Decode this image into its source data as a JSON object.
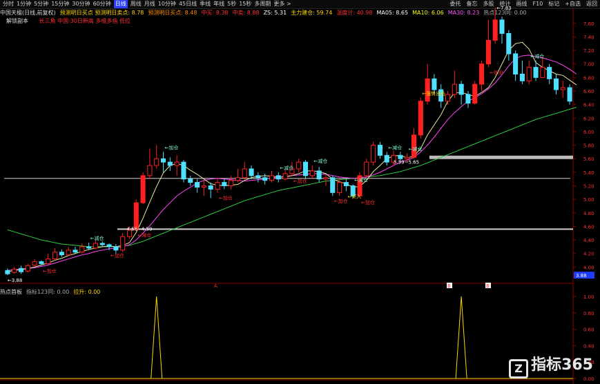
{
  "toolbar": {
    "timeframes": [
      "分时",
      "1分钟",
      "5分钟",
      "15分钟",
      "30分钟",
      "60分钟",
      "日线",
      "周线",
      "月线",
      "10分钟",
      "45日线",
      "季线",
      "年线",
      "5秒",
      "15秒",
      "多周期",
      "更多 >"
    ],
    "active_index": 6,
    "right": [
      "委托",
      "备忘",
      "多股",
      "统计",
      "画线",
      "F10",
      "标记",
      "+自选",
      "返回"
    ]
  },
  "infobar": {
    "title": "中国天楹(日线,前复权)",
    "items": [
      {
        "text": "预测明日买点 预测明日卖点: 8.78",
        "color": "#ffd700"
      },
      {
        "text": "预测明日买点: 8.48",
        "color": "#ff8c00"
      },
      {
        "text": "中买: 8.38",
        "color": "#ff3030"
      },
      {
        "text": "中卖: 8.88",
        "color": "#ff3030"
      },
      {
        "text": "ZS: 5.31",
        "color": "#ffffff"
      },
      {
        "text": "主力建仓: 59.74",
        "color": "#ffd700"
      },
      {
        "text": "温度计: 40.98",
        "color": "#ff3030"
      },
      {
        "text": "MA05: 8.65",
        "color": "#ffffff"
      },
      {
        "text": "MA10: 6.06",
        "color": "#ffff00"
      },
      {
        "text": "MA30: 8.23",
        "color": "#ff55ff"
      },
      {
        "text": "热点123同: 0.00",
        "color": "#aaaaaa"
      }
    ]
  },
  "tags": {
    "box": "解锁副本",
    "formula": "长三角 中国·30日新高 多维多指 低位"
  },
  "indbar": {
    "items": [
      {
        "text": "热点首板",
        "color": "#dddddd"
      },
      {
        "text": "指标123同: 0.00",
        "color": "#aaaaaa"
      },
      {
        "text": "拉升: 0.00",
        "color": "#ffd700"
      }
    ]
  },
  "axis": {
    "main": [
      "7.60",
      "7.40",
      "7.20",
      "7.00",
      "6.80",
      "6.60",
      "6.40",
      "6.20",
      "6.00",
      "5.80",
      "5.60",
      "5.40",
      "5.20",
      "5.00",
      "4.80",
      "4.60",
      "4.40",
      "4.20",
      "4.00"
    ],
    "current_price": "3.88",
    "sub": [
      "1.00",
      "0.80",
      "0.60",
      "0.40",
      "0.20",
      "0.00"
    ]
  },
  "annotations": {
    "high": "7.83",
    "low": "3.88",
    "level1": "4.56~4.59",
    "level2": "5.59~5.65",
    "labels": [
      "加仓",
      "减仓",
      "加仓",
      "减仓",
      "加仓",
      "加仓",
      "减仓",
      "加仓",
      "减仓",
      "加仓",
      "减仓",
      "加仓",
      "买入",
      "减仓",
      "减仓",
      "强势出击",
      "加仓",
      "减仓"
    ]
  },
  "markers": {
    "a1": "A",
    "a2": "A",
    "b1": "B",
    "b2": "B"
  },
  "chart_data": {
    "type": "line",
    "title": "中国天楹(日线,前复权)",
    "ylim": [
      3.8,
      7.7
    ],
    "candles": [
      {
        "o": 3.95,
        "c": 3.9,
        "h": 3.98,
        "l": 3.88
      },
      {
        "o": 3.92,
        "c": 3.97,
        "h": 4.0,
        "l": 3.9
      },
      {
        "o": 3.98,
        "c": 3.93,
        "h": 4.02,
        "l": 3.9
      },
      {
        "o": 3.94,
        "c": 4.02,
        "h": 4.05,
        "l": 3.92
      },
      {
        "o": 4.03,
        "c": 4.08,
        "h": 4.12,
        "l": 4.0
      },
      {
        "o": 4.08,
        "c": 4.05,
        "h": 4.1,
        "l": 4.02
      },
      {
        "o": 4.05,
        "c": 4.12,
        "h": 4.2,
        "l": 4.03
      },
      {
        "o": 4.12,
        "c": 4.22,
        "h": 4.28,
        "l": 4.1
      },
      {
        "o": 4.22,
        "c": 4.18,
        "h": 4.26,
        "l": 4.15
      },
      {
        "o": 4.18,
        "c": 4.25,
        "h": 4.3,
        "l": 4.16
      },
      {
        "o": 4.25,
        "c": 4.22,
        "h": 4.3,
        "l": 4.2
      },
      {
        "o": 4.22,
        "c": 4.3,
        "h": 4.35,
        "l": 4.2
      },
      {
        "o": 4.3,
        "c": 4.28,
        "h": 4.36,
        "l": 4.25
      },
      {
        "o": 4.28,
        "c": 4.35,
        "h": 4.4,
        "l": 4.26
      },
      {
        "o": 4.35,
        "c": 4.33,
        "h": 4.38,
        "l": 4.3
      },
      {
        "o": 4.33,
        "c": 4.3,
        "h": 4.35,
        "l": 4.25
      },
      {
        "o": 4.3,
        "c": 4.25,
        "h": 4.34,
        "l": 4.2
      },
      {
        "o": 4.25,
        "c": 4.45,
        "h": 4.5,
        "l": 4.22
      },
      {
        "o": 4.45,
        "c": 4.55,
        "h": 4.6,
        "l": 4.42
      },
      {
        "o": 4.55,
        "c": 4.95,
        "h": 5.0,
        "l": 4.55
      },
      {
        "o": 4.95,
        "c": 5.35,
        "h": 5.4,
        "l": 4.93
      },
      {
        "o": 5.35,
        "c": 5.5,
        "h": 5.75,
        "l": 5.3
      },
      {
        "o": 5.5,
        "c": 5.6,
        "h": 5.8,
        "l": 5.45
      },
      {
        "o": 5.6,
        "c": 5.55,
        "h": 5.7,
        "l": 5.4
      },
      {
        "o": 5.55,
        "c": 5.5,
        "h": 5.62,
        "l": 5.42
      },
      {
        "o": 5.5,
        "c": 5.55,
        "h": 5.65,
        "l": 5.35
      },
      {
        "o": 5.55,
        "c": 5.3,
        "h": 5.58,
        "l": 5.25
      },
      {
        "o": 5.3,
        "c": 5.25,
        "h": 5.35,
        "l": 5.2
      },
      {
        "o": 5.25,
        "c": 5.18,
        "h": 5.3,
        "l": 5.1
      },
      {
        "o": 5.18,
        "c": 5.2,
        "h": 5.28,
        "l": 5.05
      },
      {
        "o": 5.2,
        "c": 5.15,
        "h": 5.25,
        "l": 5.02
      },
      {
        "o": 5.15,
        "c": 5.25,
        "h": 5.32,
        "l": 5.1
      },
      {
        "o": 5.25,
        "c": 5.2,
        "h": 5.3,
        "l": 5.15
      },
      {
        "o": 5.2,
        "c": 5.28,
        "h": 5.35,
        "l": 5.15
      },
      {
        "o": 5.28,
        "c": 5.32,
        "h": 5.45,
        "l": 5.25
      },
      {
        "o": 5.32,
        "c": 5.45,
        "h": 5.55,
        "l": 5.28
      },
      {
        "o": 5.45,
        "c": 5.35,
        "h": 5.5,
        "l": 5.3
      },
      {
        "o": 5.35,
        "c": 5.32,
        "h": 5.4,
        "l": 5.25
      },
      {
        "o": 5.32,
        "c": 5.28,
        "h": 5.38,
        "l": 5.22
      },
      {
        "o": 5.28,
        "c": 5.35,
        "h": 5.42,
        "l": 5.25
      },
      {
        "o": 5.35,
        "c": 5.3,
        "h": 5.4,
        "l": 5.25
      },
      {
        "o": 5.3,
        "c": 5.38,
        "h": 5.45,
        "l": 5.28
      },
      {
        "o": 5.38,
        "c": 5.45,
        "h": 5.55,
        "l": 5.35
      },
      {
        "o": 5.45,
        "c": 5.55,
        "h": 5.6,
        "l": 5.4
      },
      {
        "o": 5.55,
        "c": 5.35,
        "h": 5.58,
        "l": 5.3
      },
      {
        "o": 5.35,
        "c": 5.42,
        "h": 5.5,
        "l": 5.3
      },
      {
        "o": 5.42,
        "c": 5.3,
        "h": 5.48,
        "l": 5.25
      },
      {
        "o": 5.3,
        "c": 5.32,
        "h": 5.36,
        "l": 5.2
      },
      {
        "o": 5.32,
        "c": 5.1,
        "h": 5.35,
        "l": 5.05
      },
      {
        "o": 5.1,
        "c": 5.25,
        "h": 5.3,
        "l": 5.05
      },
      {
        "o": 5.25,
        "c": 5.2,
        "h": 5.3,
        "l": 5.12
      },
      {
        "o": 5.2,
        "c": 5.05,
        "h": 5.22,
        "l": 5.02
      },
      {
        "o": 5.05,
        "c": 5.35,
        "h": 5.4,
        "l": 5.03
      },
      {
        "o": 5.35,
        "c": 5.55,
        "h": 5.6,
        "l": 5.3
      },
      {
        "o": 5.55,
        "c": 5.8,
        "h": 5.85,
        "l": 5.5
      },
      {
        "o": 5.8,
        "c": 5.65,
        "h": 5.85,
        "l": 5.6
      },
      {
        "o": 5.65,
        "c": 5.55,
        "h": 5.7,
        "l": 5.5
      },
      {
        "o": 5.55,
        "c": 5.65,
        "h": 5.72,
        "l": 5.5
      },
      {
        "o": 5.65,
        "c": 5.6,
        "h": 5.7,
        "l": 5.55
      },
      {
        "o": 5.6,
        "c": 5.62,
        "h": 5.68,
        "l": 5.55
      },
      {
        "o": 5.62,
        "c": 5.95,
        "h": 6.05,
        "l": 5.6
      },
      {
        "o": 5.95,
        "c": 6.45,
        "h": 6.5,
        "l": 5.9
      },
      {
        "o": 6.45,
        "c": 6.78,
        "h": 7.0,
        "l": 6.4
      },
      {
        "o": 6.78,
        "c": 6.62,
        "h": 6.85,
        "l": 6.55
      },
      {
        "o": 6.62,
        "c": 6.45,
        "h": 6.7,
        "l": 6.35
      },
      {
        "o": 6.45,
        "c": 6.55,
        "h": 6.6,
        "l": 6.4
      },
      {
        "o": 6.55,
        "c": 6.7,
        "h": 6.9,
        "l": 6.5
      },
      {
        "o": 6.7,
        "c": 6.55,
        "h": 6.75,
        "l": 6.4
      },
      {
        "o": 6.55,
        "c": 6.42,
        "h": 6.6,
        "l": 6.35
      },
      {
        "o": 6.42,
        "c": 6.7,
        "h": 6.75,
        "l": 6.4
      },
      {
        "o": 6.7,
        "c": 7.0,
        "h": 7.05,
        "l": 6.6
      },
      {
        "o": 7.0,
        "c": 7.35,
        "h": 7.65,
        "l": 6.95
      },
      {
        "o": 7.35,
        "c": 7.65,
        "h": 7.83,
        "l": 7.3
      },
      {
        "o": 7.65,
        "c": 7.45,
        "h": 7.7,
        "l": 7.3
      },
      {
        "o": 7.45,
        "c": 7.15,
        "h": 7.5,
        "l": 7.05
      },
      {
        "o": 7.15,
        "c": 6.85,
        "h": 7.2,
        "l": 6.75
      },
      {
        "o": 6.85,
        "c": 6.75,
        "h": 7.05,
        "l": 6.7
      },
      {
        "o": 6.75,
        "c": 6.95,
        "h": 7.05,
        "l": 6.7
      },
      {
        "o": 6.95,
        "c": 6.8,
        "h": 7.05,
        "l": 6.75
      },
      {
        "o": 6.8,
        "c": 6.95,
        "h": 7.1,
        "l": 6.8
      },
      {
        "o": 6.95,
        "c": 6.78,
        "h": 7.0,
        "l": 6.7
      },
      {
        "o": 6.78,
        "c": 6.62,
        "h": 6.85,
        "l": 6.55
      },
      {
        "o": 6.62,
        "c": 6.65,
        "h": 6.75,
        "l": 6.5
      },
      {
        "o": 6.65,
        "c": 6.45,
        "h": 6.7,
        "l": 6.4
      }
    ],
    "h_levels": [
      5.62,
      5.31,
      4.56
    ],
    "ma5": [
      3.93,
      3.95,
      3.96,
      3.98,
      4.0,
      4.03,
      4.06,
      4.1,
      4.13,
      4.17,
      4.2,
      4.23,
      4.26,
      4.28,
      4.3,
      4.31,
      4.3,
      4.32,
      4.36,
      4.51,
      4.72,
      4.96,
      5.19,
      5.39,
      5.5,
      5.53,
      5.5,
      5.43,
      5.37,
      5.3,
      5.23,
      5.21,
      5.2,
      5.21,
      5.22,
      5.28,
      5.32,
      5.34,
      5.35,
      5.34,
      5.33,
      5.33,
      5.35,
      5.38,
      5.42,
      5.42,
      5.41,
      5.38,
      5.3,
      5.26,
      5.23,
      5.18,
      5.19,
      5.28,
      5.41,
      5.5,
      5.6,
      5.64,
      5.65,
      5.61,
      5.64,
      5.75,
      5.95,
      6.1,
      6.25,
      6.45,
      6.57,
      6.58,
      6.55,
      6.52,
      6.58,
      6.65,
      6.8,
      7.0,
      7.2,
      7.3,
      7.32,
      7.22,
      7.02,
      6.95,
      6.9,
      6.85,
      6.83,
      6.76,
      6.69
    ],
    "ma10": [
      3.95,
      3.96,
      3.97,
      3.98,
      3.99,
      4.01,
      4.03,
      4.06,
      4.09,
      4.12,
      4.15,
      4.18,
      4.2,
      4.23,
      4.25,
      4.27,
      4.28,
      4.3,
      4.33,
      4.4,
      4.5,
      4.61,
      4.73,
      4.85,
      4.95,
      5.05,
      5.12,
      5.18,
      5.24,
      5.28,
      5.3,
      5.31,
      5.3,
      5.29,
      5.28,
      5.27,
      5.28,
      5.29,
      5.3,
      5.32,
      5.33,
      5.34,
      5.35,
      5.36,
      5.37,
      5.38,
      5.38,
      5.37,
      5.35,
      5.33,
      5.32,
      5.31,
      5.32,
      5.33,
      5.36,
      5.4,
      5.45,
      5.5,
      5.55,
      5.58,
      5.62,
      5.7,
      5.8,
      5.92,
      6.05,
      6.18,
      6.28,
      6.37,
      6.45,
      6.5,
      6.56,
      6.63,
      6.72,
      6.84,
      6.97,
      7.08,
      7.12,
      7.13,
      7.11,
      7.09,
      7.06,
      7.03,
      6.98,
      6.92,
      6.85
    ],
    "ma30": [
      4.55,
      4.52,
      4.49,
      4.46,
      4.43,
      4.4,
      4.38,
      4.36,
      4.34,
      4.33,
      4.32,
      4.31,
      4.3,
      4.3,
      4.3,
      4.3,
      4.3,
      4.31,
      4.32,
      4.35,
      4.38,
      4.42,
      4.46,
      4.5,
      4.54,
      4.58,
      4.62,
      4.66,
      4.7,
      4.74,
      4.78,
      4.82,
      4.86,
      4.9,
      4.94,
      4.98,
      5.01,
      5.04,
      5.07,
      5.1,
      5.13,
      5.15,
      5.17,
      5.19,
      5.21,
      5.23,
      5.25,
      5.27,
      5.28,
      5.29,
      5.3,
      5.31,
      5.32,
      5.33,
      5.34,
      5.35,
      5.37,
      5.39,
      5.41,
      5.44,
      5.47,
      5.5,
      5.54,
      5.58,
      5.62,
      5.66,
      5.7,
      5.74,
      5.78,
      5.82,
      5.86,
      5.9,
      5.94,
      5.98,
      6.02,
      6.06,
      6.1,
      6.14,
      6.18,
      6.21,
      6.24,
      6.27,
      6.3,
      6.33,
      6.36
    ],
    "ind_spikes": [
      22,
      67
    ]
  }
}
